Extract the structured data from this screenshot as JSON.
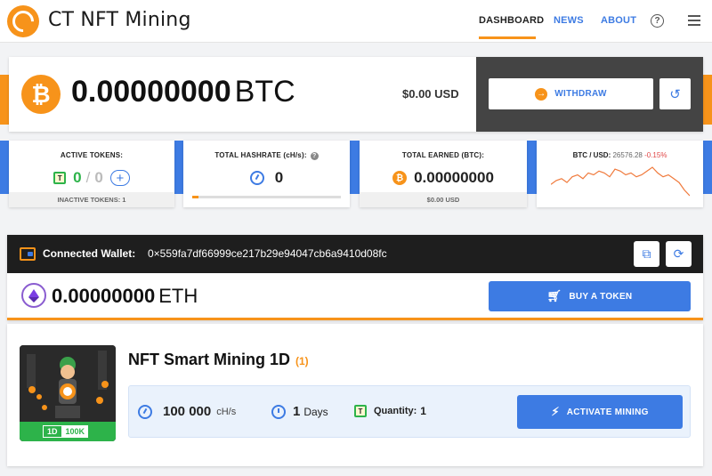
{
  "header": {
    "title": "CT NFT Mining",
    "nav": {
      "dashboard": "DASHBOARD",
      "news": "NEWS",
      "about": "ABOUT"
    },
    "help_glyph": "?"
  },
  "balance": {
    "btc_glyph": "₿",
    "amount": "0.00000000",
    "unit": "BTC",
    "usd": "$0.00 USD",
    "withdraw_label": "WITHDRAW"
  },
  "stats": {
    "active_tokens": {
      "title": "ACTIVE TOKENS:",
      "badge": "T",
      "active": "0",
      "separator": "/",
      "total": "0",
      "add_glyph": "+",
      "footer": "INACTIVE TOKENS: 1"
    },
    "hashrate": {
      "title": "TOTAL HASHRATE (cH/s):",
      "info_glyph": "?",
      "value": "0",
      "progress": 0.04
    },
    "earned": {
      "title": "TOTAL EARNED (BTC):",
      "btc_glyph": "₿",
      "value": "0.00000000",
      "footer": "$0.00 USD"
    },
    "price": {
      "label": "BTC / USD:",
      "value": "26576.28",
      "change": "-0.15%"
    }
  },
  "chart_data": {
    "type": "line",
    "series": [
      {
        "values": [
          14,
          12,
          11,
          13,
          10,
          9,
          11,
          8,
          9,
          7,
          8,
          10,
          6,
          7,
          9,
          8,
          10,
          9,
          7,
          5,
          8,
          10,
          9,
          11,
          13,
          17,
          20
        ]
      }
    ],
    "color": "#f07a3c"
  },
  "wallet": {
    "label": "Connected Wallet:",
    "address": "0×559fa7df66999ce217b29e94047cb6a9410d08fc",
    "eth_amount": "0.00000000",
    "eth_unit": "ETH",
    "buy_label": "BUY A TOKEN"
  },
  "nft": {
    "title": "NFT Smart Mining 1D",
    "count": "(1)",
    "tag_days": "1D",
    "tag_hash": "100K",
    "hashrate": "100 000",
    "hashrate_unit": "cH/s",
    "days": "1",
    "days_unit": "Days",
    "qty_badge": "T",
    "qty_label": "Quantity:",
    "qty_value": "1",
    "activate_label": "ACTIVATE MINING"
  },
  "colors": {
    "orange": "#f7931a",
    "blue": "#3d7be3",
    "green": "#2db34a",
    "red": "#e04646"
  }
}
